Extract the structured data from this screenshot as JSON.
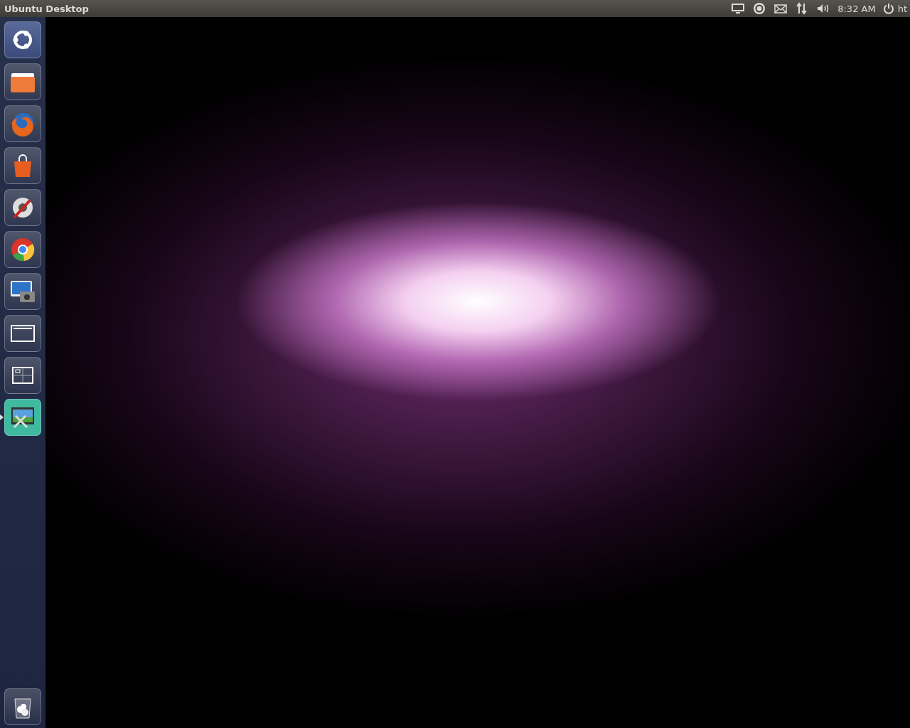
{
  "top_bar": {
    "title": "Ubuntu Desktop",
    "indicators": [
      {
        "kind": "display"
      },
      {
        "kind": "ubuntu-one"
      },
      {
        "kind": "mail"
      },
      {
        "kind": "network"
      },
      {
        "kind": "sound"
      },
      {
        "kind": "clock",
        "label": "8:32 AM"
      },
      {
        "kind": "session",
        "label": "ht"
      }
    ]
  },
  "launcher": {
    "items": [
      {
        "kind": "dash",
        "running": false
      },
      {
        "kind": "files",
        "running": false
      },
      {
        "kind": "firefox",
        "running": false
      },
      {
        "kind": "software-center",
        "running": false
      },
      {
        "kind": "settings",
        "running": false
      },
      {
        "kind": "chrome",
        "running": false
      },
      {
        "kind": "screenshot",
        "running": false
      },
      {
        "kind": "window",
        "running": false
      },
      {
        "kind": "workspaces",
        "running": false
      },
      {
        "kind": "video-editor",
        "running": true
      }
    ],
    "bottom": [
      {
        "kind": "trash",
        "running": false
      }
    ]
  }
}
